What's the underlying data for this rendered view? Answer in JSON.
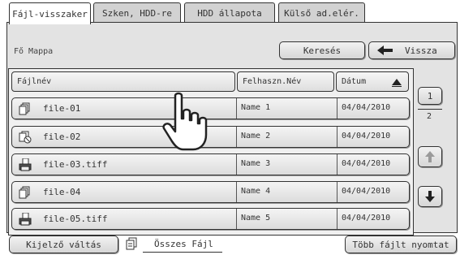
{
  "tabs": [
    {
      "label": "Fájl-visszaker",
      "active": true
    },
    {
      "label": "Szken, HDD-re",
      "active": false
    },
    {
      "label": "HDD állapota",
      "active": false
    },
    {
      "label": "Külső ad.elér.",
      "active": false
    }
  ],
  "header": {
    "folder": "Fő Mappa",
    "search_label": "Keresés",
    "back_label": "Vissza"
  },
  "columns": {
    "filename": "Fájlnév",
    "username": "Felhaszn.Név",
    "date": "Dátum"
  },
  "rows": [
    {
      "icon": "stack-document-icon",
      "name": "file-01",
      "user": "Name 1",
      "date": "04/04/2010"
    },
    {
      "icon": "document-forbidden-icon",
      "name": "file-02",
      "user": "Name 2",
      "date": "04/04/2010"
    },
    {
      "icon": "printer-icon",
      "name": "file-03.tiff",
      "user": "Name 3",
      "date": "04/04/2010"
    },
    {
      "icon": "stack-document-icon",
      "name": "file-04",
      "user": "Name 4",
      "date": "04/04/2010"
    },
    {
      "icon": "printer-icon",
      "name": "file-05.tiff",
      "user": "Name 5",
      "date": "04/04/2010"
    }
  ],
  "pager": {
    "current": "1",
    "total": "2"
  },
  "footer": {
    "display_toggle": "Kijelző váltás",
    "all_files": "Összes Fájl",
    "multi_print": "Több fájlt nyomtat"
  },
  "colors": {
    "panel": "#e3e3e3",
    "border": "#333333",
    "button_top": "#f4f4f4",
    "button_bottom": "#dcdcdc"
  }
}
